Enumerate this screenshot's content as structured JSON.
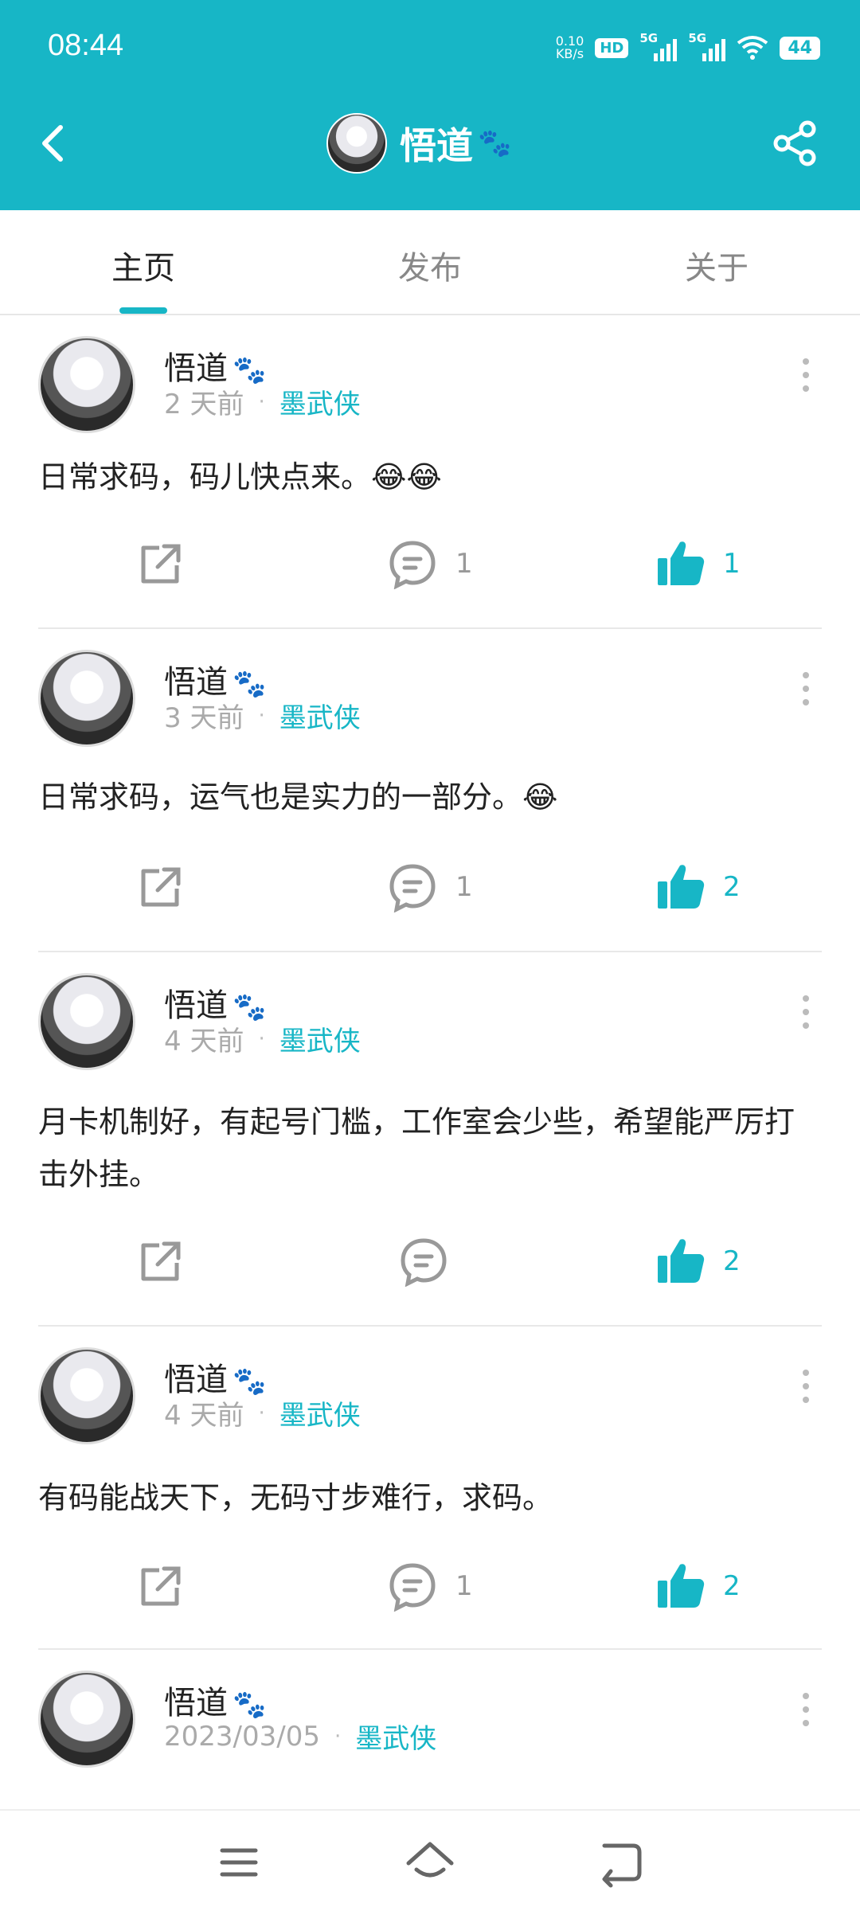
{
  "status_bar": {
    "time": "08:44",
    "net_speed_value": "0.10",
    "net_speed_unit": "KB/s",
    "hd": "HD",
    "sim1": "5G",
    "sim2": "5G",
    "battery": "44"
  },
  "header": {
    "title": "悟道",
    "paw_icon": "🐾",
    "accent_color": "#17b6c6"
  },
  "tabs": [
    {
      "label": "主页",
      "active": true
    },
    {
      "label": "发布",
      "active": false
    },
    {
      "label": "关于",
      "active": false
    }
  ],
  "posts": [
    {
      "author": "悟道",
      "time": "2 天前",
      "game": "墨武侠",
      "text": "日常求码，码儿快点来。😂😂",
      "comments": "1",
      "likes": "1"
    },
    {
      "author": "悟道",
      "time": "3 天前",
      "game": "墨武侠",
      "text": "日常求码，运气也是实力的一部分。😂",
      "comments": "1",
      "likes": "2"
    },
    {
      "author": "悟道",
      "time": "4 天前",
      "game": "墨武侠",
      "text": "月卡机制好，有起号门槛，工作室会少些，希望能严厉打击外挂。",
      "comments": "",
      "likes": "2"
    },
    {
      "author": "悟道",
      "time": "4 天前",
      "game": "墨武侠",
      "text": "有码能战天下，无码寸步难行，求码。",
      "comments": "1",
      "likes": "2"
    },
    {
      "author": "悟道",
      "time": "2023/03/05",
      "game": "墨武侠",
      "text": "",
      "comments": "",
      "likes": ""
    }
  ],
  "bottom_nav": {
    "icons": [
      "menu-icon",
      "home-icon",
      "back-icon"
    ]
  }
}
